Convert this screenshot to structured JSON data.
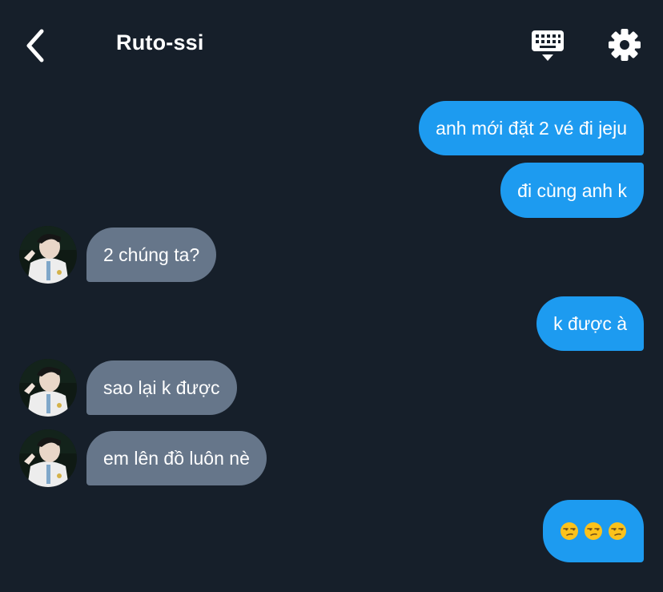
{
  "header": {
    "title": "Ruto-ssi",
    "back_icon": "chevron-left-icon",
    "keyboard_icon": "keyboard-icon",
    "settings_icon": "gear-icon"
  },
  "colors": {
    "background": "#161f2a",
    "outgoing_bubble": "#1d9bf0",
    "incoming_bubble": "#66768a",
    "text": "#ffffff"
  },
  "messages": [
    {
      "sender": "me",
      "text": "anh mới đặt 2 vé đi jeju"
    },
    {
      "sender": "me",
      "text": "đi cùng anh k"
    },
    {
      "sender": "Ruto-ssi",
      "text": "2 chúng ta?"
    },
    {
      "sender": "me",
      "text": "k được à"
    },
    {
      "sender": "Ruto-ssi",
      "text": "sao lại k được"
    },
    {
      "sender": "Ruto-ssi",
      "text": "em lên đồ luôn nè"
    },
    {
      "sender": "me",
      "text": "😒😒😒",
      "emoji_count": 3,
      "emoji_name": "unamused-face"
    }
  ]
}
